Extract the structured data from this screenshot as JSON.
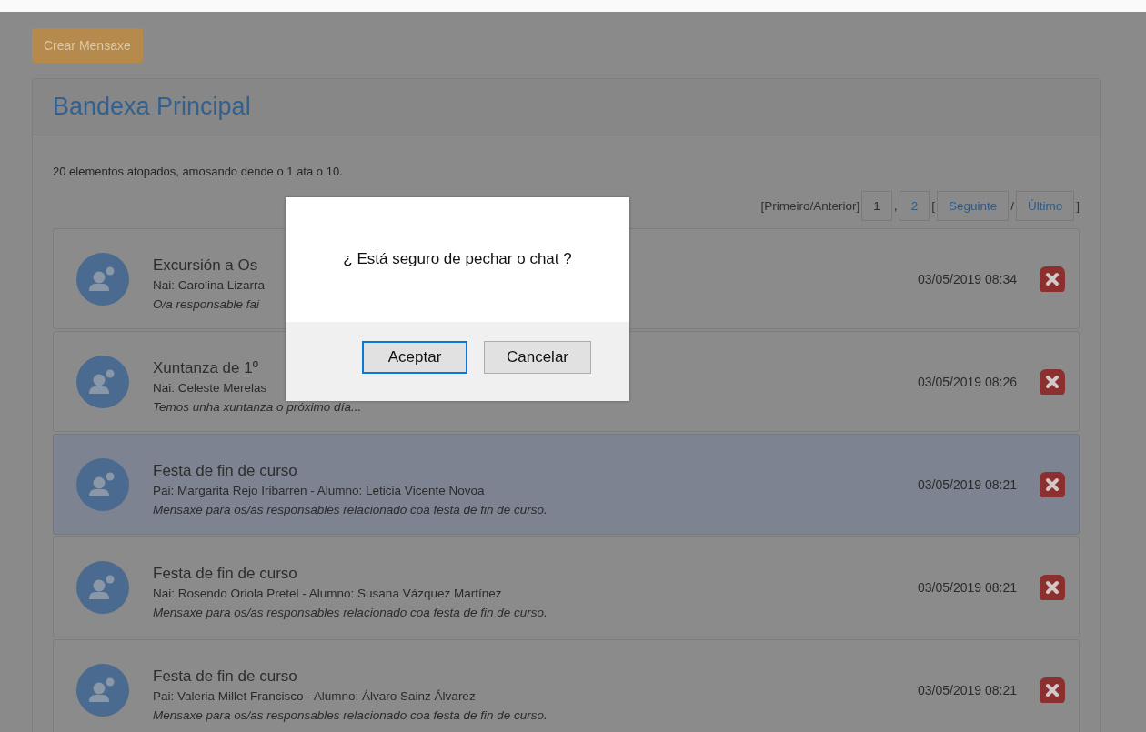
{
  "create_button": "Crear Mensaxe",
  "panel": {
    "title": "Bandexa Principal",
    "summary": "20 elementos atopados, amosando dende o 1 ata o 10.",
    "pagination": {
      "first_prev": "[Primeiro/Anterior]",
      "pages": [
        {
          "label": "1",
          "selected": true
        },
        {
          "label": "2",
          "selected": false
        }
      ],
      "separator": ",",
      "open_bracket": "[",
      "next": "Seguinte",
      "slash": "/",
      "last": "Último",
      "close_bracket": "]"
    },
    "messages": [
      {
        "title": "Excursión a Os",
        "from": "Nai: Carolina Lizarra",
        "preview": "O/a responsable fai",
        "date": "03/05/2019 08:34",
        "highlighted": false
      },
      {
        "title": "Xuntanza de 1º",
        "from": "Nai: Celeste Merelas",
        "preview": "Temos unha xuntanza o próximo día...",
        "date": "03/05/2019 08:26",
        "highlighted": false
      },
      {
        "title": "Festa de fin de curso",
        "from": "Pai: Margarita Rejo Iribarren - Alumno: Leticia Vicente Novoa",
        "preview": "Mensaxe para os/as responsables relacionado coa festa de fin de curso.",
        "date": "03/05/2019 08:21",
        "highlighted": true
      },
      {
        "title": "Festa de fin de curso",
        "from": "Nai: Rosendo Oriola Pretel - Alumno: Susana Vázquez Martínez",
        "preview": "Mensaxe para os/as responsables relacionado coa festa de fin de curso.",
        "date": "03/05/2019 08:21",
        "highlighted": false
      },
      {
        "title": "Festa de fin de curso",
        "from": "Pai: Valeria Millet Francisco - Alumno: Álvaro Sainz Álvarez",
        "preview": "Mensaxe para os/as responsables relacionado coa festa de fin de curso.",
        "date": "03/05/2019 08:21",
        "highlighted": false
      }
    ]
  },
  "dialog": {
    "message": "¿ Está seguro de pechar o chat ?",
    "buttons": [
      {
        "label": "Aceptar",
        "focused": true
      },
      {
        "label": "Cancelar",
        "focused": false
      }
    ]
  }
}
